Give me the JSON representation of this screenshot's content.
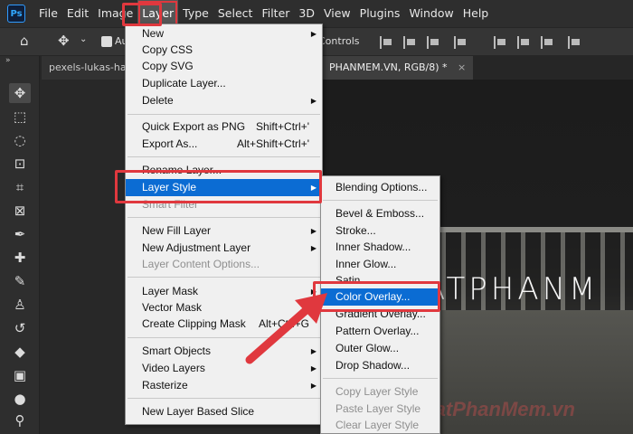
{
  "menubar": {
    "logo": "Ps",
    "items": [
      "File",
      "Edit",
      "Image",
      "Layer",
      "Type",
      "Select",
      "Filter",
      "3D",
      "View",
      "Plugins",
      "Window",
      "Help"
    ]
  },
  "options": {
    "auto_label": "Au",
    "controls_label": "Controls"
  },
  "toolbar": {
    "collapse": "»"
  },
  "tabs": {
    "left": "pexels-lukas-har",
    "right": "PHANMEM.VN, RGB/8) *",
    "close": "×"
  },
  "canvas": {
    "overlay_text": "UATPHANM",
    "watermark": "ThuThuatPhanMem.vn"
  },
  "layer_menu": {
    "items": [
      {
        "label": "New",
        "shortcut": "",
        "arrow": true,
        "state": "normal"
      },
      {
        "label": "Copy CSS",
        "shortcut": "",
        "arrow": false,
        "state": "normal"
      },
      {
        "label": "Copy SVG",
        "shortcut": "",
        "arrow": false,
        "state": "normal"
      },
      {
        "label": "Duplicate Layer...",
        "shortcut": "",
        "arrow": false,
        "state": "normal"
      },
      {
        "label": "Delete",
        "shortcut": "",
        "arrow": true,
        "state": "normal"
      },
      {
        "label": "Quick Export as PNG",
        "shortcut": "Shift+Ctrl+'",
        "arrow": false,
        "state": "normal"
      },
      {
        "label": "Export As...",
        "shortcut": "Alt+Shift+Ctrl+'",
        "arrow": false,
        "state": "normal"
      },
      {
        "label": "Rename Layer...",
        "shortcut": "",
        "arrow": false,
        "state": "normal"
      },
      {
        "label": "Layer Style",
        "shortcut": "",
        "arrow": true,
        "state": "highlighted"
      },
      {
        "label": "Smart Filter",
        "shortcut": "",
        "arrow": false,
        "state": "disabled"
      },
      {
        "label": "New Fill Layer",
        "shortcut": "",
        "arrow": true,
        "state": "normal"
      },
      {
        "label": "New Adjustment Layer",
        "shortcut": "",
        "arrow": true,
        "state": "normal"
      },
      {
        "label": "Layer Content Options...",
        "shortcut": "",
        "arrow": false,
        "state": "disabled"
      },
      {
        "label": "Layer Mask",
        "shortcut": "",
        "arrow": true,
        "state": "normal"
      },
      {
        "label": "Vector Mask",
        "shortcut": "",
        "arrow": true,
        "state": "normal"
      },
      {
        "label": "Create Clipping Mask",
        "shortcut": "Alt+Ctrl+G",
        "arrow": false,
        "state": "normal"
      },
      {
        "label": "Smart Objects",
        "shortcut": "",
        "arrow": true,
        "state": "normal"
      },
      {
        "label": "Video Layers",
        "shortcut": "",
        "arrow": true,
        "state": "normal"
      },
      {
        "label": "Rasterize",
        "shortcut": "",
        "arrow": true,
        "state": "normal"
      },
      {
        "label": "New Layer Based Slice",
        "shortcut": "",
        "arrow": false,
        "state": "normal"
      }
    ]
  },
  "style_menu": {
    "items": [
      {
        "label": "Blending Options...",
        "state": "normal"
      },
      {
        "label": "Bevel & Emboss...",
        "state": "normal"
      },
      {
        "label": "Stroke...",
        "state": "normal"
      },
      {
        "label": "Inner Shadow...",
        "state": "normal"
      },
      {
        "label": "Inner Glow...",
        "state": "normal"
      },
      {
        "label": "Satin...",
        "state": "normal"
      },
      {
        "label": "Color Overlay...",
        "state": "highlighted"
      },
      {
        "label": "Gradient Overlay...",
        "state": "normal"
      },
      {
        "label": "Pattern Overlay...",
        "state": "normal"
      },
      {
        "label": "Outer Glow...",
        "state": "normal"
      },
      {
        "label": "Drop Shadow...",
        "state": "normal"
      },
      {
        "label": "Copy Layer Style",
        "state": "disabled"
      },
      {
        "label": "Paste Layer Style",
        "state": "disabled"
      },
      {
        "label": "Clear Layer Style",
        "state": "disabled"
      }
    ]
  },
  "colors": {
    "highlight": "#0b6cd3",
    "annotation_red": "#e0383e"
  }
}
